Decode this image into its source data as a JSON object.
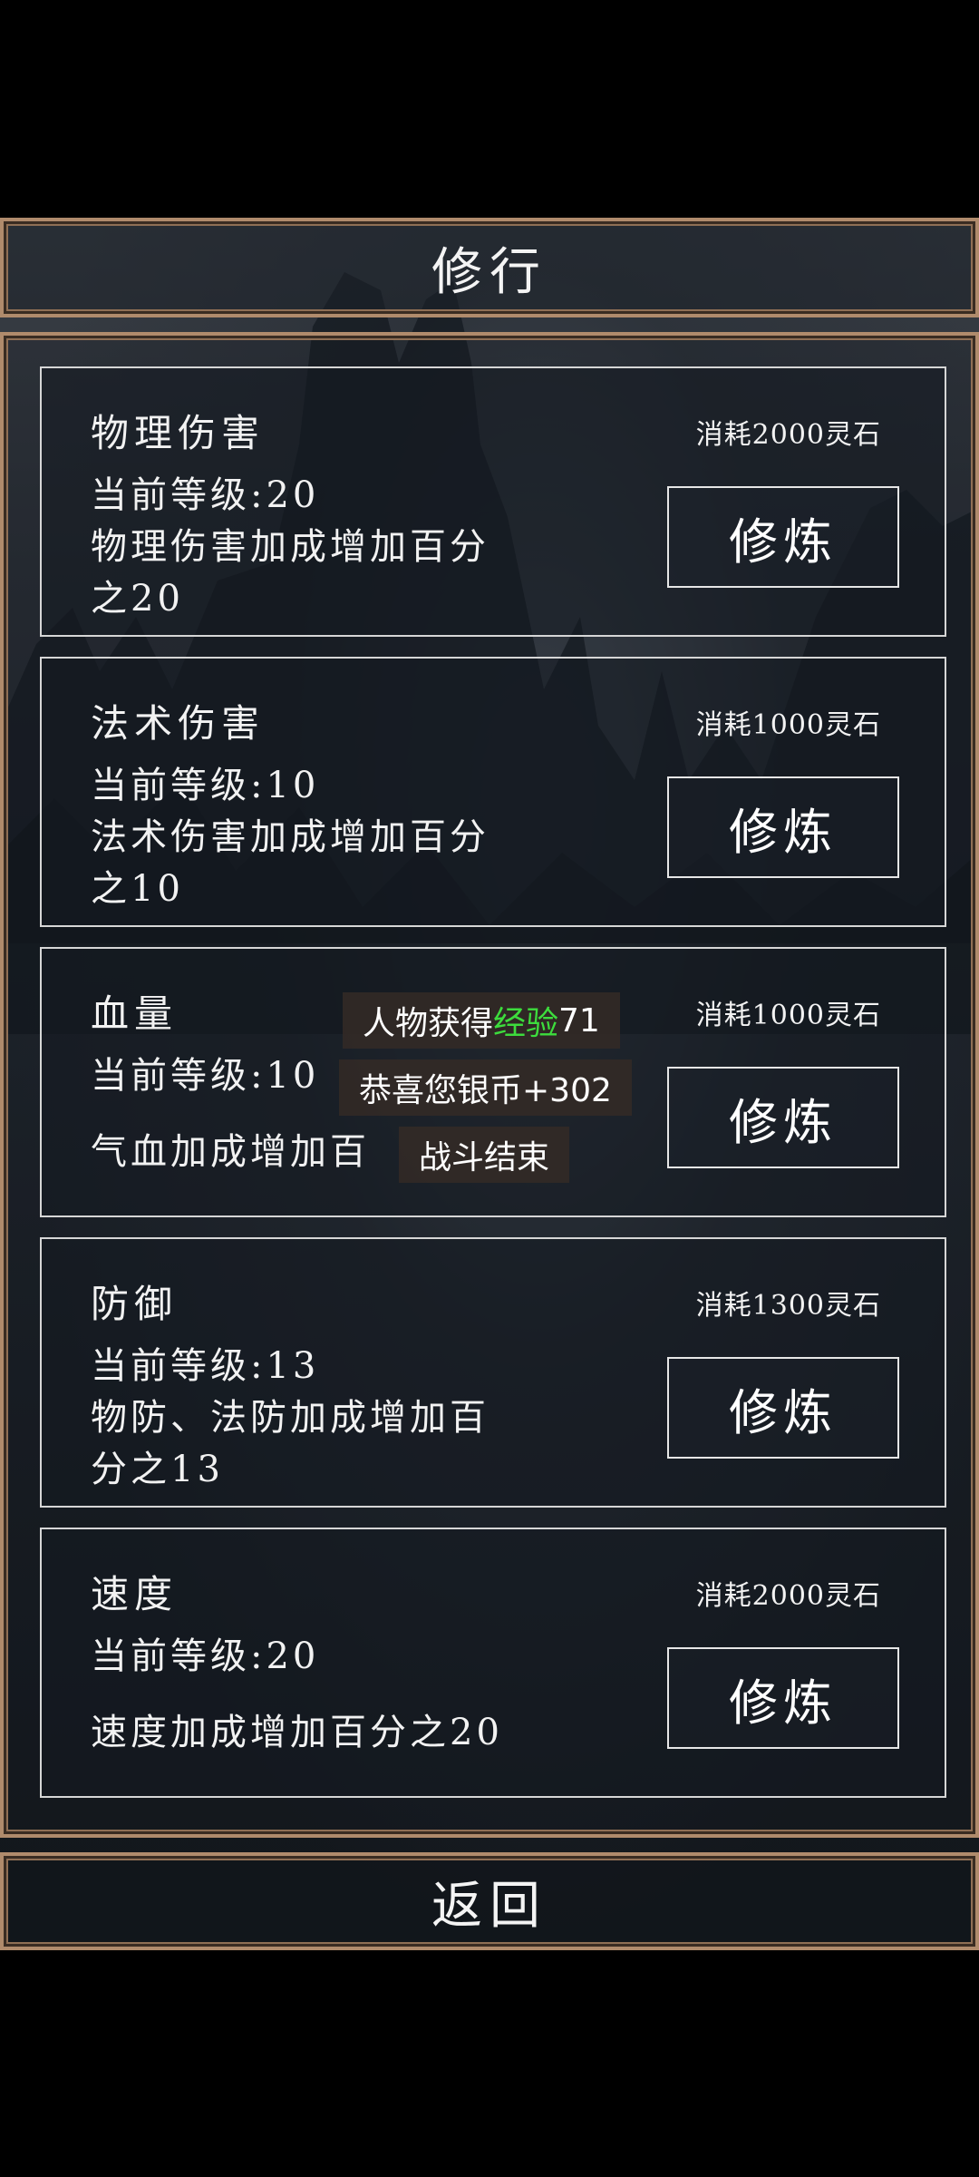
{
  "header": {
    "title": "修行"
  },
  "footer": {
    "back_label": "返回"
  },
  "cards": [
    {
      "name": "物理伤害",
      "cost": "消耗2000灵石",
      "level": "当前等级:20",
      "effect_line1": "物理伤害加成增加百分",
      "effect_line2": "之20",
      "button": "修炼"
    },
    {
      "name": "法术伤害",
      "cost": "消耗1000灵石",
      "level": "当前等级:10",
      "effect_line1": "法术伤害加成增加百分",
      "effect_line2": "之10",
      "button": "修炼"
    },
    {
      "name": "血量",
      "cost": "消耗1000灵石",
      "level": "当前等级:10",
      "effect_line1": "气血加成增加百",
      "effect_line2": "",
      "button": "修炼"
    },
    {
      "name": "防御",
      "cost": "消耗1300灵石",
      "level": "当前等级:13",
      "effect_line1": "物防、法防加成增加百",
      "effect_line2": "分之13",
      "button": "修炼"
    },
    {
      "name": "速度",
      "cost": "消耗2000灵石",
      "level": "当前等级:20",
      "effect_line1": "速度加成增加百分之20",
      "effect_line2": "",
      "button": "修炼"
    }
  ],
  "toasts": {
    "exp_prefix": "人物获得",
    "exp_highlight": "经验",
    "exp_value": "71",
    "silver": "恭喜您银币+302",
    "battle_end": "战斗结束"
  },
  "colors": {
    "frame": "#b08b6c",
    "highlight": "#3ddc3d"
  }
}
